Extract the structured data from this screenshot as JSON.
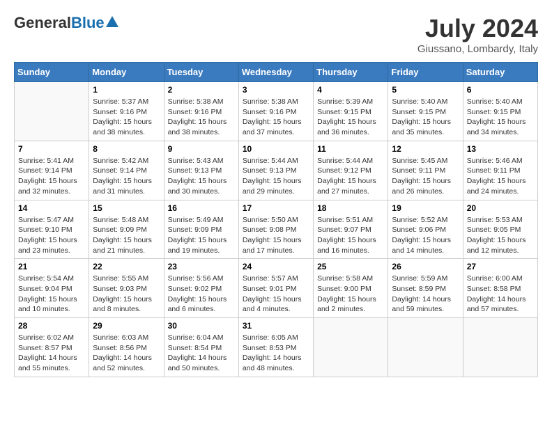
{
  "logo": {
    "general": "General",
    "blue": "Blue"
  },
  "title": "July 2024",
  "location": "Giussano, Lombardy, Italy",
  "weekdays": [
    "Sunday",
    "Monday",
    "Tuesday",
    "Wednesday",
    "Thursday",
    "Friday",
    "Saturday"
  ],
  "weeks": [
    [
      {
        "day": "",
        "info": ""
      },
      {
        "day": "1",
        "info": "Sunrise: 5:37 AM\nSunset: 9:16 PM\nDaylight: 15 hours\nand 38 minutes."
      },
      {
        "day": "2",
        "info": "Sunrise: 5:38 AM\nSunset: 9:16 PM\nDaylight: 15 hours\nand 38 minutes."
      },
      {
        "day": "3",
        "info": "Sunrise: 5:38 AM\nSunset: 9:16 PM\nDaylight: 15 hours\nand 37 minutes."
      },
      {
        "day": "4",
        "info": "Sunrise: 5:39 AM\nSunset: 9:15 PM\nDaylight: 15 hours\nand 36 minutes."
      },
      {
        "day": "5",
        "info": "Sunrise: 5:40 AM\nSunset: 9:15 PM\nDaylight: 15 hours\nand 35 minutes."
      },
      {
        "day": "6",
        "info": "Sunrise: 5:40 AM\nSunset: 9:15 PM\nDaylight: 15 hours\nand 34 minutes."
      }
    ],
    [
      {
        "day": "7",
        "info": "Sunrise: 5:41 AM\nSunset: 9:14 PM\nDaylight: 15 hours\nand 32 minutes."
      },
      {
        "day": "8",
        "info": "Sunrise: 5:42 AM\nSunset: 9:14 PM\nDaylight: 15 hours\nand 31 minutes."
      },
      {
        "day": "9",
        "info": "Sunrise: 5:43 AM\nSunset: 9:13 PM\nDaylight: 15 hours\nand 30 minutes."
      },
      {
        "day": "10",
        "info": "Sunrise: 5:44 AM\nSunset: 9:13 PM\nDaylight: 15 hours\nand 29 minutes."
      },
      {
        "day": "11",
        "info": "Sunrise: 5:44 AM\nSunset: 9:12 PM\nDaylight: 15 hours\nand 27 minutes."
      },
      {
        "day": "12",
        "info": "Sunrise: 5:45 AM\nSunset: 9:11 PM\nDaylight: 15 hours\nand 26 minutes."
      },
      {
        "day": "13",
        "info": "Sunrise: 5:46 AM\nSunset: 9:11 PM\nDaylight: 15 hours\nand 24 minutes."
      }
    ],
    [
      {
        "day": "14",
        "info": "Sunrise: 5:47 AM\nSunset: 9:10 PM\nDaylight: 15 hours\nand 23 minutes."
      },
      {
        "day": "15",
        "info": "Sunrise: 5:48 AM\nSunset: 9:09 PM\nDaylight: 15 hours\nand 21 minutes."
      },
      {
        "day": "16",
        "info": "Sunrise: 5:49 AM\nSunset: 9:09 PM\nDaylight: 15 hours\nand 19 minutes."
      },
      {
        "day": "17",
        "info": "Sunrise: 5:50 AM\nSunset: 9:08 PM\nDaylight: 15 hours\nand 17 minutes."
      },
      {
        "day": "18",
        "info": "Sunrise: 5:51 AM\nSunset: 9:07 PM\nDaylight: 15 hours\nand 16 minutes."
      },
      {
        "day": "19",
        "info": "Sunrise: 5:52 AM\nSunset: 9:06 PM\nDaylight: 15 hours\nand 14 minutes."
      },
      {
        "day": "20",
        "info": "Sunrise: 5:53 AM\nSunset: 9:05 PM\nDaylight: 15 hours\nand 12 minutes."
      }
    ],
    [
      {
        "day": "21",
        "info": "Sunrise: 5:54 AM\nSunset: 9:04 PM\nDaylight: 15 hours\nand 10 minutes."
      },
      {
        "day": "22",
        "info": "Sunrise: 5:55 AM\nSunset: 9:03 PM\nDaylight: 15 hours\nand 8 minutes."
      },
      {
        "day": "23",
        "info": "Sunrise: 5:56 AM\nSunset: 9:02 PM\nDaylight: 15 hours\nand 6 minutes."
      },
      {
        "day": "24",
        "info": "Sunrise: 5:57 AM\nSunset: 9:01 PM\nDaylight: 15 hours\nand 4 minutes."
      },
      {
        "day": "25",
        "info": "Sunrise: 5:58 AM\nSunset: 9:00 PM\nDaylight: 15 hours\nand 2 minutes."
      },
      {
        "day": "26",
        "info": "Sunrise: 5:59 AM\nSunset: 8:59 PM\nDaylight: 14 hours\nand 59 minutes."
      },
      {
        "day": "27",
        "info": "Sunrise: 6:00 AM\nSunset: 8:58 PM\nDaylight: 14 hours\nand 57 minutes."
      }
    ],
    [
      {
        "day": "28",
        "info": "Sunrise: 6:02 AM\nSunset: 8:57 PM\nDaylight: 14 hours\nand 55 minutes."
      },
      {
        "day": "29",
        "info": "Sunrise: 6:03 AM\nSunset: 8:56 PM\nDaylight: 14 hours\nand 52 minutes."
      },
      {
        "day": "30",
        "info": "Sunrise: 6:04 AM\nSunset: 8:54 PM\nDaylight: 14 hours\nand 50 minutes."
      },
      {
        "day": "31",
        "info": "Sunrise: 6:05 AM\nSunset: 8:53 PM\nDaylight: 14 hours\nand 48 minutes."
      },
      {
        "day": "",
        "info": ""
      },
      {
        "day": "",
        "info": ""
      },
      {
        "day": "",
        "info": ""
      }
    ]
  ]
}
